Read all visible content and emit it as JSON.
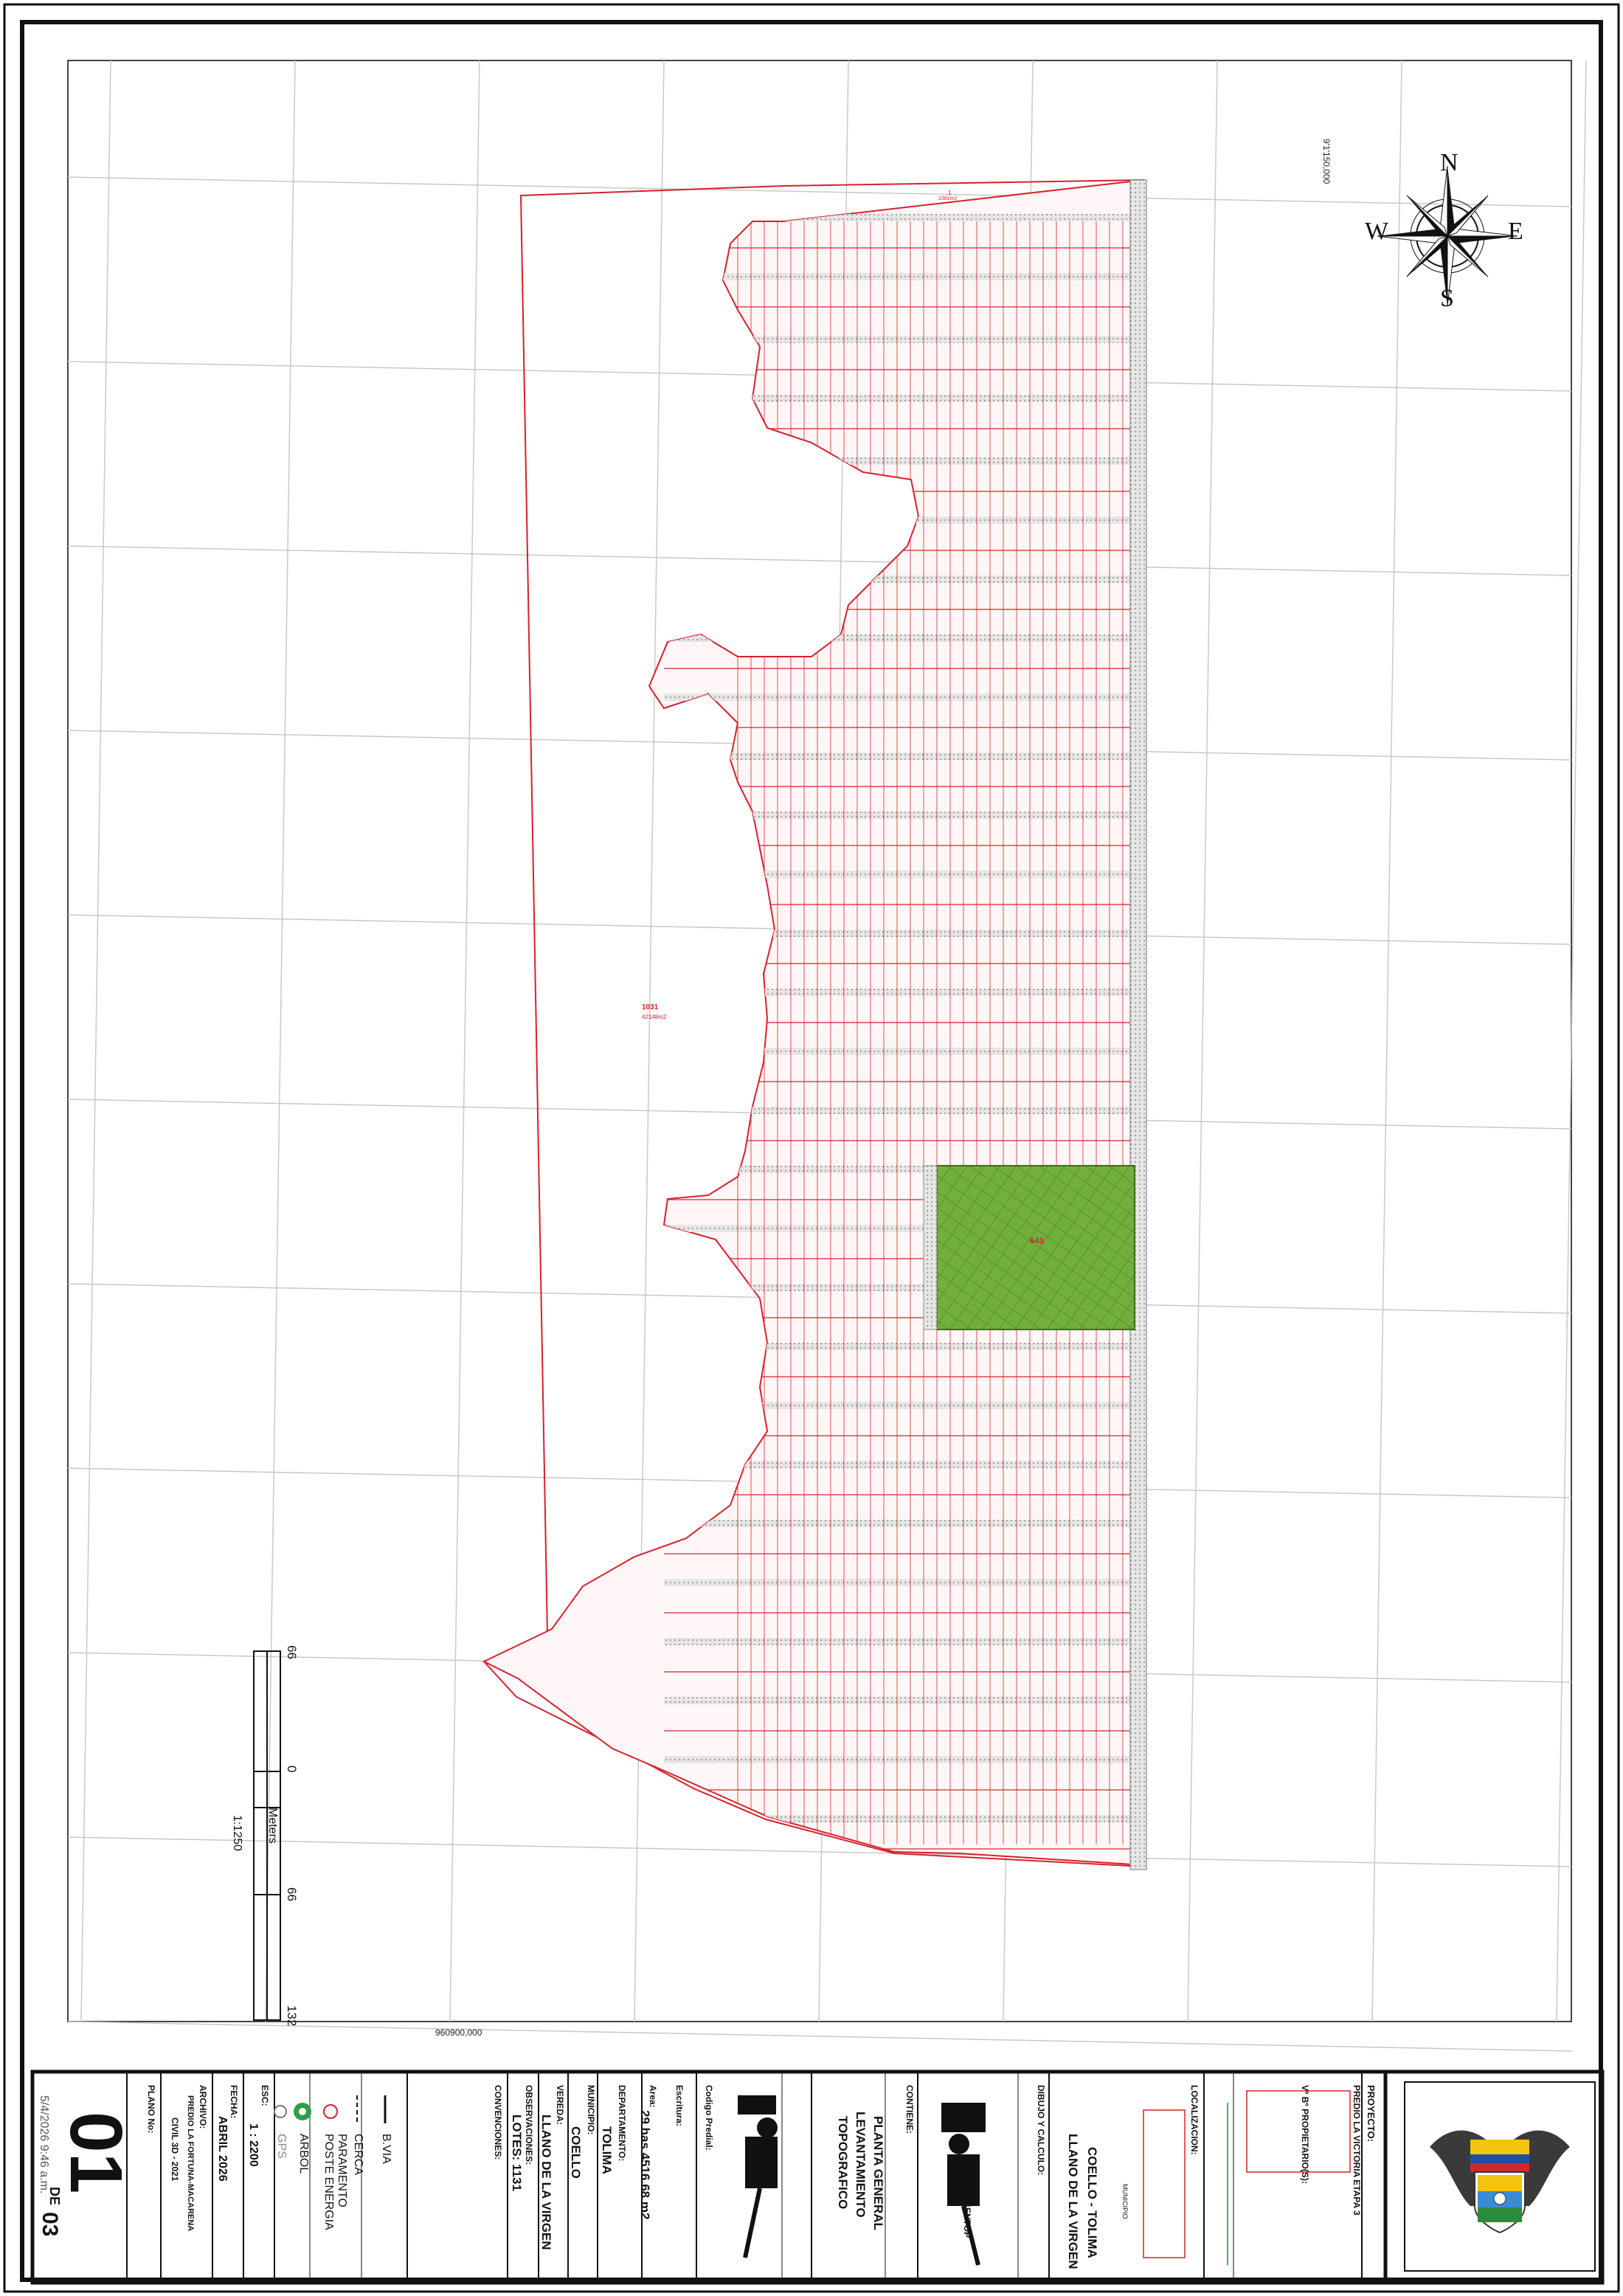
{
  "map": {
    "north_coord": "9'1'150,000",
    "east_coord": "960900,000",
    "park_lot": "643",
    "large_lot": "1031",
    "large_lot_area": "42148m2",
    "top_lot": "1",
    "top_lot_area": "2381m2"
  },
  "compass": {
    "n": "N",
    "s": "S",
    "e": "E",
    "w": "W"
  },
  "scale_bar": {
    "ticks": [
      "66",
      "0",
      "66",
      "132"
    ],
    "unit": "Meters",
    "ratio": "1:1250"
  },
  "title_block": {
    "proyecto_label": "PROYECTO:",
    "proyecto_value": "PREDIO LA VICTORIA ETAPA 3",
    "propietarios_label": "Vº Bº PROPIETARIO(S):",
    "localizacion_label": "LOCALIZACION:",
    "localizacion_value1": "COELLO - TOLIMA",
    "localizacion_value2": "LLANO DE LA VIRGEN",
    "municipio_tag": "MUNICIPIO",
    "dibujo_label": "DIBUJO Y CALCULO:",
    "dibujo_value": "DISENTOP",
    "contiene_label": "CONTIENE:",
    "contiene_value1": "PLANTA GENERAL",
    "contiene_value2": "LEVANTAMIENTO",
    "contiene_value3": "TOPOGRAFICO",
    "codigo_label": "Codigo Predial:",
    "escritura_label": "Escritura:",
    "area_label": "Area:",
    "area_value": "29 has 4516.68 m2",
    "departamento_label": "DEPARTAMENTO:",
    "departamento_value": "TOLIMA",
    "municipio_label": "MUNICIPIO:",
    "municipio_value": "COELLO",
    "vereda_label": "VEREDA:",
    "vereda_value": "LLANO DE LA VIRGEN",
    "observaciones_label": "OBSERVACIONES:",
    "observaciones_value": "LOTES: 1131",
    "convenciones_label": "CONVENCIONES:",
    "legend": [
      "B.VIA",
      "CERCA",
      "PARAMENTO",
      "POSTE ENERGIA",
      "ARBOL",
      "GPS"
    ],
    "esc_label": "ESC:",
    "esc_value": "1 : 2200",
    "fecha_label": "FECHA:",
    "fecha_value": "ABRIL 2026",
    "archivo_label": "ARCHIVO:",
    "archivo_value1": "PREDIO LA FORTUNA-MACARENA",
    "archivo_value2": "CIVIL 3D - 2021",
    "plano_label": "PLANO No:",
    "plano_value": "01",
    "de_label": "DE",
    "de_value": "03",
    "timestamp": "5/4/2026 9:46 a.m."
  },
  "colors": {
    "lot_red": "#d9202c",
    "park_green": "#6fae3a",
    "road_gray": "#c8c8c8"
  }
}
